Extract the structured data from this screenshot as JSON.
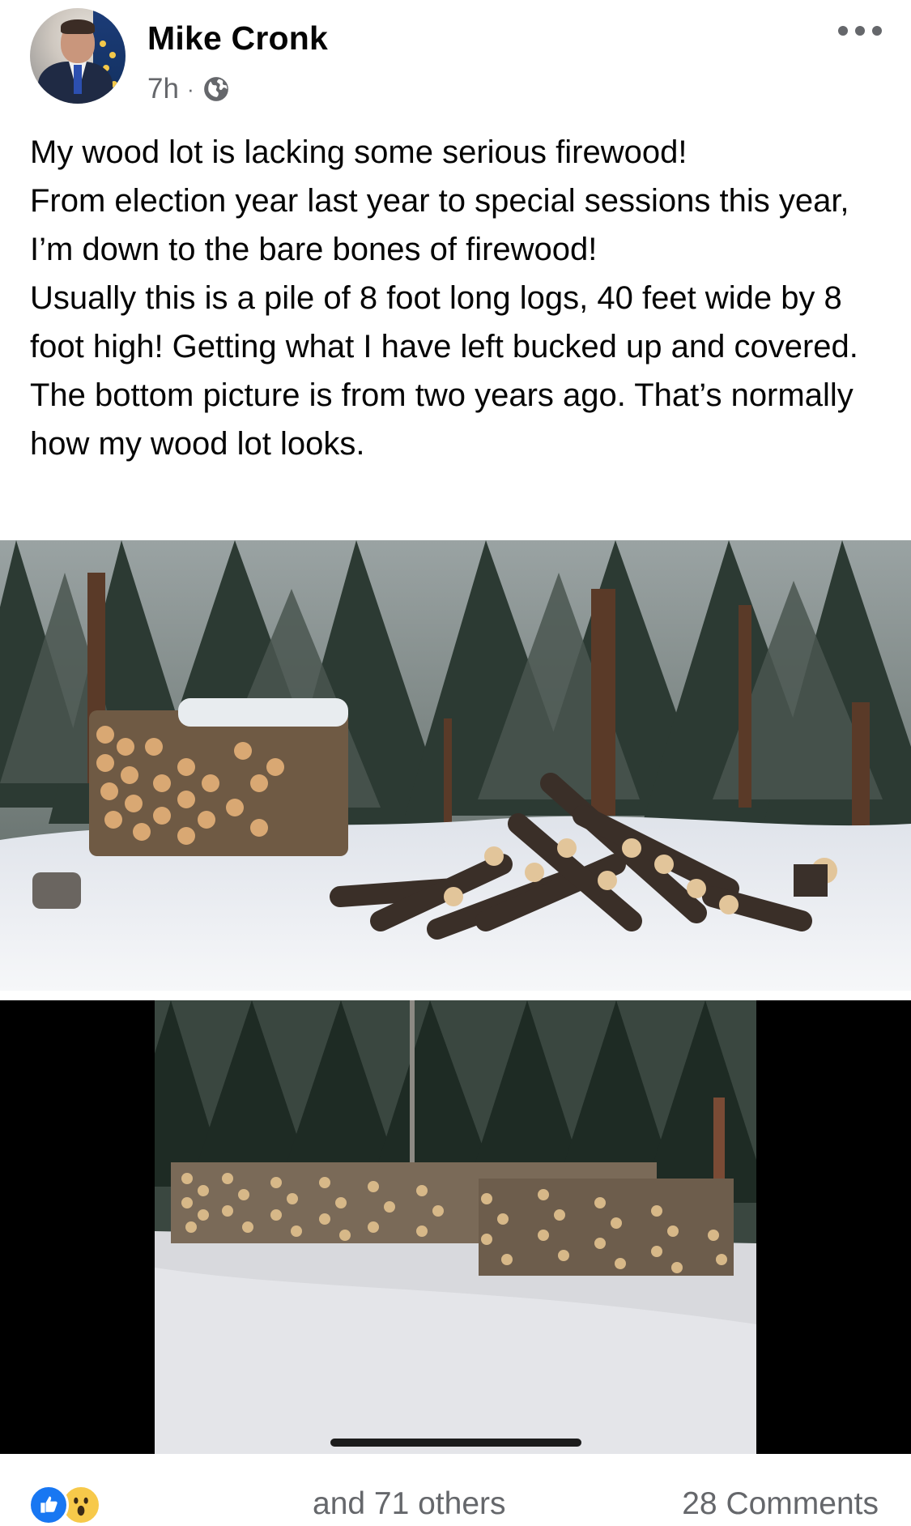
{
  "post": {
    "author": "Mike Cronk",
    "timestamp": "7h",
    "separator": "·",
    "privacy_icon": "globe-icon",
    "text": "My wood lot is lacking some serious firewood!\nFrom election year last year to special sessions this year, I’m down to the bare bones of firewood!\nUsually this is a pile of 8 foot long logs, 40 feet wide by 8 foot high!  Getting what I have left bucked up and covered. The bottom picture is from two years ago. That’s normally how my wood lot looks."
  },
  "footer": {
    "reaction_icons": [
      "like-icon",
      "wow-icon"
    ],
    "reaction_text": "and 71 others",
    "comments_text": "28 Comments"
  },
  "colors": {
    "secondary_text": "#65676b",
    "like_blue": "#1877f2",
    "wow_yellow": "#f7c94a"
  }
}
